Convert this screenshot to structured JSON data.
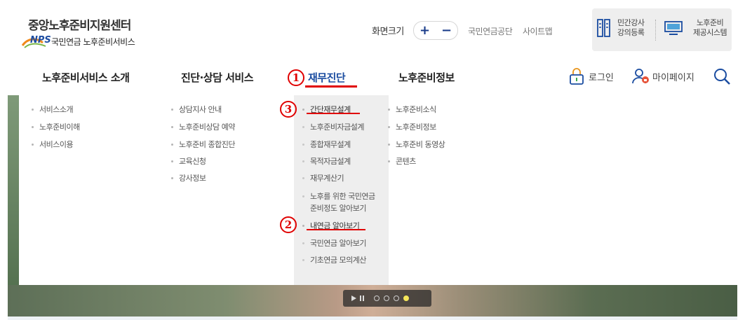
{
  "header": {
    "org_title": "중앙노후준비지원센터",
    "nps_mark": "NPS",
    "nps_name": "국민연금 노후준비서비스",
    "zoom_label": "화면크기",
    "zoom_in": "+",
    "zoom_out": "−",
    "links": [
      "국민연금공단",
      "사이트맵"
    ],
    "util": [
      {
        "label_line1": "민간강사",
        "label_line2": "강의등록",
        "icon": "document-icon"
      },
      {
        "label_line1": "노후준비",
        "label_line2": "제공시스템",
        "icon": "monitor-icon"
      }
    ]
  },
  "nav": {
    "items": [
      "노후준비서비스 소개",
      "진단·상담 서비스",
      "재무진단",
      "노후준비정보"
    ],
    "active_index": 2,
    "login": "로그인",
    "mypage": "마이페이지"
  },
  "dropdown": {
    "col1": [
      "서비스소개",
      "노후준비이해",
      "서비스이용"
    ],
    "col2": [
      "상담지사 안내",
      "노후준비상담 예약",
      "노후준비 종합진단",
      "교육신청",
      "강사정보"
    ],
    "col3": {
      "head1": "간단재무설계",
      "sub1": [
        "노후준비자금설계",
        "종합재무설계",
        "목적자금설계",
        "재무계산기"
      ],
      "sub1_multiline_line1": "노후를 위한 국민연금",
      "sub1_multiline_line2": "준비정도 알아보기",
      "head2": "내연금 알아보기",
      "sub2": [
        "국민연금 알아보기",
        "기초연금 모의계산"
      ]
    },
    "col4": [
      "노후준비소식",
      "노후준비정보",
      "노후준비 동영상",
      "콘텐츠"
    ]
  },
  "annotations": [
    "1",
    "2",
    "3"
  ],
  "colors": {
    "accent_red": "#e00000",
    "nav_active": "#1a4ca0",
    "brand_blue": "#1f4fa3"
  },
  "slider": {
    "dots": 4,
    "active_dot": 4
  }
}
